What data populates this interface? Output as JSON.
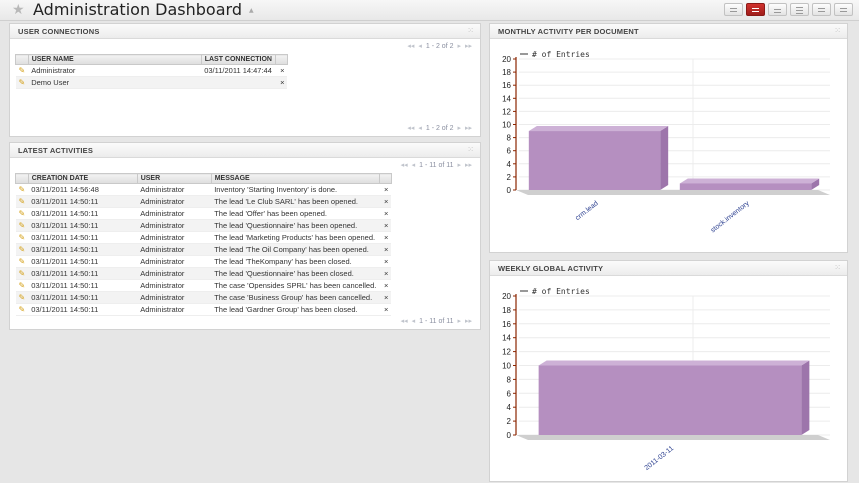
{
  "header": {
    "title": "Administration Dashboard"
  },
  "user_connections": {
    "title": "USER CONNECTIONS",
    "pager_top": "1 - 2 of 2",
    "pager_bottom": "1 - 2 of 2",
    "columns": [
      "USER NAME",
      "LAST CONNECTION"
    ],
    "rows": [
      {
        "user": "Administrator",
        "last": "03/11/2011 14:47:44"
      },
      {
        "user": "Demo User",
        "last": ""
      }
    ]
  },
  "latest_activities": {
    "title": "LATEST ACTIVITIES",
    "pager_top": "1 - 11 of 11",
    "pager_bottom": "1 - 11 of 11",
    "columns": [
      "CREATION DATE",
      "USER",
      "MESSAGE"
    ],
    "rows": [
      {
        "date": "03/11/2011 14:56:48",
        "user": "Administrator",
        "message": "Inventory 'Starting Inventory' is done."
      },
      {
        "date": "03/11/2011 14:50:11",
        "user": "Administrator",
        "message": "The lead 'Le Club SARL' has been opened."
      },
      {
        "date": "03/11/2011 14:50:11",
        "user": "Administrator",
        "message": "The lead 'Offer' has been opened."
      },
      {
        "date": "03/11/2011 14:50:11",
        "user": "Administrator",
        "message": "The lead 'Questionnaire' has been opened."
      },
      {
        "date": "03/11/2011 14:50:11",
        "user": "Administrator",
        "message": "The lead 'Marketing Products' has been opened."
      },
      {
        "date": "03/11/2011 14:50:11",
        "user": "Administrator",
        "message": "The lead 'The Oil Company' has been opened."
      },
      {
        "date": "03/11/2011 14:50:11",
        "user": "Administrator",
        "message": "The lead 'TheKompany' has been closed."
      },
      {
        "date": "03/11/2011 14:50:11",
        "user": "Administrator",
        "message": "The lead 'Questionnaire' has been closed."
      },
      {
        "date": "03/11/2011 14:50:11",
        "user": "Administrator",
        "message": "The case 'Opensides SPRL' has been cancelled."
      },
      {
        "date": "03/11/2011 14:50:11",
        "user": "Administrator",
        "message": "The case 'Business Group' has been cancelled."
      },
      {
        "date": "03/11/2011 14:50:11",
        "user": "Administrator",
        "message": "The lead 'Gardner Group' has been closed."
      }
    ]
  },
  "monthly_activity": {
    "title": "MONTHLY ACTIVITY PER DOCUMENT"
  },
  "weekly_activity": {
    "title": "WEEKLY GLOBAL ACTIVITY"
  },
  "colors": {
    "bar": "#b58fc0",
    "bar_top": "#cdb1d6",
    "bar_side": "#9d75ab",
    "axis": "#8b2500",
    "accent": "#b8302c"
  },
  "chart_data": [
    {
      "type": "bar",
      "title": "MONTHLY ACTIVITY PER DOCUMENT",
      "categories": [
        "crm.lead",
        "stock.inventory"
      ],
      "series": [
        {
          "name": "# of Entries",
          "values": [
            9,
            1
          ]
        }
      ],
      "ylim": [
        0,
        20
      ],
      "yticks": [
        0,
        2,
        4,
        6,
        8,
        10,
        12,
        14,
        16,
        18,
        20
      ],
      "legend": "top-left",
      "grid": true
    },
    {
      "type": "bar",
      "title": "WEEKLY GLOBAL ACTIVITY",
      "categories": [
        "2011-03-11"
      ],
      "series": [
        {
          "name": "# of Entries",
          "values": [
            10
          ]
        }
      ],
      "ylim": [
        0,
        20
      ],
      "yticks": [
        0,
        2,
        4,
        6,
        8,
        10,
        12,
        14,
        16,
        18,
        20
      ],
      "legend": "top-left",
      "grid": true
    }
  ]
}
